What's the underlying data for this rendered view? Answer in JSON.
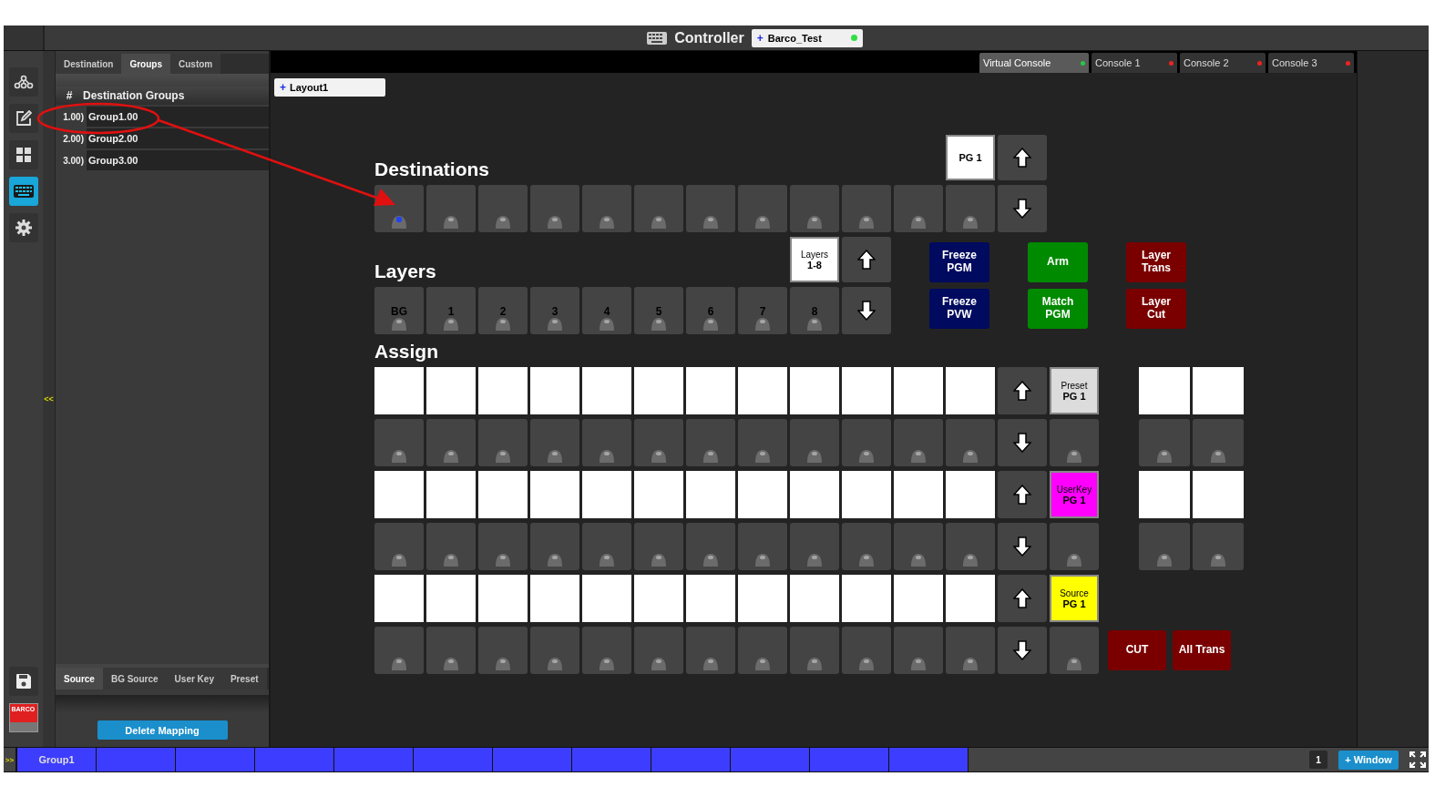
{
  "window": {
    "title": "Controller",
    "project_add": "+",
    "project": "Barco_Test"
  },
  "consoles": [
    {
      "label": "Virtual Console",
      "selected": true,
      "color": "#22cc44"
    },
    {
      "label": "Console 1",
      "selected": false,
      "color": "#ee2222"
    },
    {
      "label": "Console 2",
      "selected": false,
      "color": "#ee2222"
    },
    {
      "label": "Console 3",
      "selected": false,
      "color": "#ee2222"
    }
  ],
  "rail": {
    "top": [
      {
        "kind": "network",
        "selected": false
      },
      {
        "kind": "edit",
        "selected": false
      },
      {
        "kind": "grid",
        "selected": false
      },
      {
        "kind": "keyboard",
        "selected": true
      },
      {
        "kind": "settings",
        "selected": false
      }
    ],
    "bottom": [
      {
        "kind": "save",
        "selected": false
      }
    ],
    "logo": "BARCO"
  },
  "collapse": "<<",
  "left_panel": {
    "tabs": [
      {
        "label": "Destination",
        "selected": false
      },
      {
        "label": "Groups",
        "selected": true
      },
      {
        "label": "Custom",
        "selected": false
      }
    ],
    "columns": {
      "number": "#",
      "name": "Destination Groups"
    },
    "groups": [
      {
        "number": "1.00)",
        "name": "Group1.00"
      },
      {
        "number": "2.00)",
        "name": "Group2.00"
      },
      {
        "number": "3.00)",
        "name": "Group3.00"
      }
    ],
    "bottom_tabs": [
      {
        "label": "Source",
        "selected": true
      },
      {
        "label": "BG Source",
        "selected": false
      },
      {
        "label": "User Key",
        "selected": false
      },
      {
        "label": "Preset",
        "selected": false
      }
    ],
    "delete_button": "Delete Mapping"
  },
  "layout_tab": {
    "add": "+",
    "label": "Layout1"
  },
  "destinations": {
    "title": "Destinations",
    "page": "PG 1",
    "buttons": [
      {
        "selected": true
      },
      {
        "selected": false
      },
      {
        "selected": false
      },
      {
        "selected": false
      },
      {
        "selected": false
      },
      {
        "selected": false
      },
      {
        "selected": false
      },
      {
        "selected": false
      },
      {
        "selected": false
      },
      {
        "selected": false
      },
      {
        "selected": false
      },
      {
        "selected": false
      }
    ]
  },
  "layers": {
    "title": "Layers",
    "range_label": "Layers",
    "range": "1-8",
    "buttons": [
      {
        "label": "BG"
      },
      {
        "label": "1"
      },
      {
        "label": "2"
      },
      {
        "label": "3"
      },
      {
        "label": "4"
      },
      {
        "label": "5"
      },
      {
        "label": "6"
      },
      {
        "label": "7"
      },
      {
        "label": "8"
      }
    ]
  },
  "functions": [
    {
      "label": "Freeze\nPGM",
      "color": "#000a5e"
    },
    {
      "label": "Freeze\nPVW",
      "color": "#000a5e"
    },
    {
      "label": "Arm",
      "color": "#008a00"
    },
    {
      "label": "Match\nPGM",
      "color": "#008a00"
    },
    {
      "label": "Layer\nTrans",
      "color": "#7a0000"
    },
    {
      "label": "Layer\nCut",
      "color": "#7a0000"
    }
  ],
  "assign": {
    "title": "Assign",
    "rows": [
      {
        "label": "Preset",
        "page": "PG 1",
        "color": "#dcdcdc",
        "extras": true
      },
      {
        "label": "UserKey",
        "page": "PG 1",
        "color": "#ff00ff",
        "extras": true
      },
      {
        "label": "Source",
        "page": "PG 1",
        "color": "#ffff00",
        "extras": false
      }
    ],
    "actions": [
      {
        "label": "CUT"
      },
      {
        "label": "All Trans"
      }
    ]
  },
  "bottom_bar": {
    "toggle": ">>",
    "slots": [
      {
        "kind": "group",
        "label": "Group1"
      },
      {
        "kind": "empty"
      },
      {
        "kind": "empty"
      },
      {
        "kind": "empty"
      },
      {
        "kind": "empty"
      },
      {
        "kind": "empty"
      },
      {
        "kind": "empty"
      },
      {
        "kind": "empty"
      },
      {
        "kind": "empty"
      },
      {
        "kind": "empty"
      },
      {
        "kind": "empty"
      },
      {
        "kind": "empty"
      }
    ],
    "page": "1",
    "add_window": "+ Window"
  }
}
